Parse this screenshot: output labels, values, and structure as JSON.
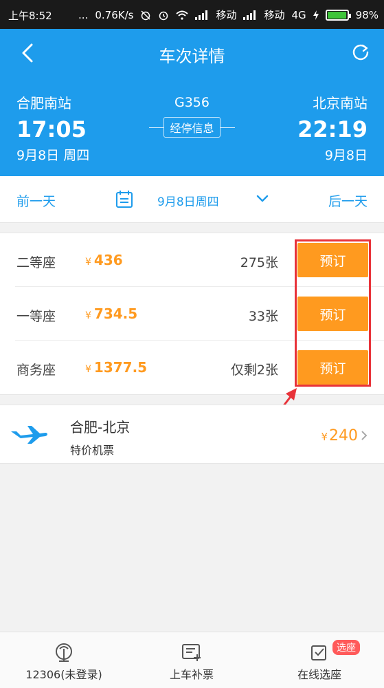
{
  "status_bar": {
    "time": "上午8:52",
    "dots": "...",
    "net_speed": "0.76K/s",
    "carrier1": "移动",
    "carrier2": "移动",
    "network": "4G",
    "battery": "98%",
    "battery_level": 0.98
  },
  "nav": {
    "title": "车次详情",
    "back_icon": "back-arrow-icon",
    "refresh_icon": "refresh-icon"
  },
  "journey": {
    "from_station": "合肥南站",
    "depart_time": "17:05",
    "depart_date": "9月8日 周四",
    "train_no": "G356",
    "stop_info_label": "经停信息",
    "to_station": "北京南站",
    "arrive_time": "22:19",
    "arrive_date": "9月8日"
  },
  "date_bar": {
    "prev_label": "前一天",
    "current_date": "9月8日周四",
    "next_label": "后一天"
  },
  "seats": [
    {
      "name": "二等座",
      "currency": "¥",
      "price": "436",
      "count": "275张",
      "button": "预订"
    },
    {
      "name": "一等座",
      "currency": "¥",
      "price": "734.5",
      "count": "33张",
      "button": "预订"
    },
    {
      "name": "商务座",
      "currency": "¥",
      "price": "1377.5",
      "count": "仅剩2张",
      "button": "预订"
    }
  ],
  "flight": {
    "route": "合肥-北京",
    "subtitle": "特价机票",
    "currency": "¥",
    "price": "240"
  },
  "tabbar": {
    "tabs": [
      {
        "label": "12306(未登录)"
      },
      {
        "label": "上车补票"
      },
      {
        "label": "在线选座"
      }
    ],
    "badge": "选座"
  },
  "colors": {
    "primary": "#1e9cec",
    "accent": "#ff9a1f",
    "highlight": "#e8333a"
  }
}
